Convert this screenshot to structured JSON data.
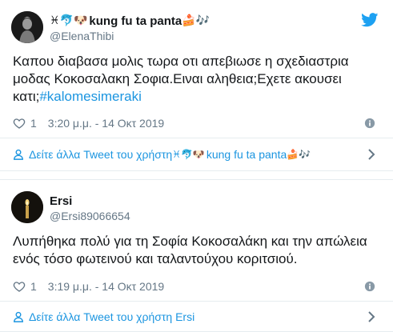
{
  "tweets": [
    {
      "display_name_prefix": "♓🐬🐶",
      "display_name": "kung fu ta panta",
      "display_name_suffix": "🍰🎶",
      "handle": "@ElenaThibi",
      "text_main": "Καπου διαβασα μολις τωρα οτι απεβιωσε η σχεδιαστρια μοδας Κοκοσαλακη Σοφια.Ειναι αληθεια;Εχετε ακουσει κατι;",
      "hashtag": "#kalomesimeraki",
      "likes": "1",
      "timestamp": "3:20 μ.μ. - 14 Οκτ 2019",
      "more_link_prefix": "Δείτε άλλα Tweet του χρήστη ",
      "more_link_name": "kung fu ta panta",
      "more_link_emoji_before": "♓🐬🐶",
      "more_link_emoji_after": "🍰🎶"
    },
    {
      "display_name": "Ersi",
      "handle": "@Ersi89066654",
      "text_main": "Λυπήθηκα πολύ για τη Σοφία Κοκοσαλάκη και την απώλεια ενός τόσο φωτεινού και ταλαντούχου κοριτσιού.",
      "likes": "1",
      "timestamp": "3:19 μ.μ. - 14 Οκτ 2019",
      "more_link": "Δείτε άλλα Tweet του χρήστη Ersi"
    }
  ],
  "colors": {
    "link": "#1b95e0",
    "text": "#14171a",
    "muted": "#657786",
    "border": "#e6ecf0",
    "twitter_blue": "#1da1f2"
  }
}
